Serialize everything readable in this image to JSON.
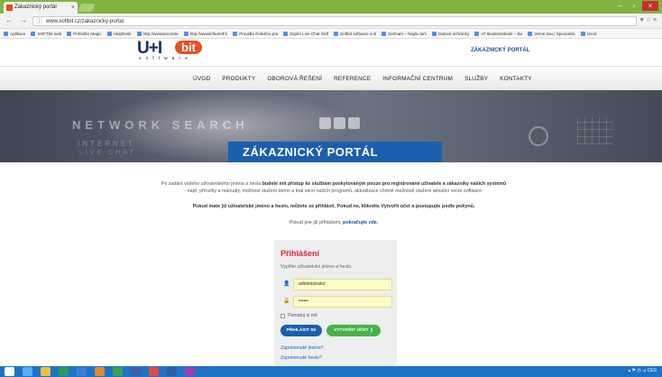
{
  "browser": {
    "tab_title": "Zákaznický portál",
    "tab_close": "×",
    "url": "www.softbit.cz/zakaznicky-portal",
    "nav_buttons": "← → C",
    "window_controls": [
      "–",
      "▫",
      "×"
    ],
    "bookmarks": [
      "Aplikace",
      "SOFTbit web",
      "Prihlašte Magic",
      "HelpDesk",
      "http://wwwsecurete",
      "http://wwwinfluentFo",
      "Pravidla českého pra",
      "Zopim Live Chat Soft",
      "Softbit software a sl",
      "Seznam – Najdu tam",
      "Datové schránky",
      "AT Businessbank – Bu",
      "Verne.sou | Specialize",
      "Úvod"
    ]
  },
  "header": {
    "logo_text": "U+I",
    "logo_badge": "bit",
    "logo_sub": "software",
    "portal_link": "ZÁKAZNICKÝ PORTÁL"
  },
  "menu": [
    "ÚVOD",
    "PRODUKTY",
    "OBOROVÁ ŘEŠENÍ",
    "REFERENCE",
    "INFORMAČNÍ CENTRUM",
    "SLUŽBY",
    "KONTAKTY"
  ],
  "banner": {
    "network_search": "NETWORK SEARCH",
    "internet": "INTERNET",
    "live_chat": "LIVE CHAT",
    "portal_title": "ZÁKAZNICKÝ PORTÁL"
  },
  "intro": {
    "line1_pre": "Po zadání vašeho uživatelského jména a hesla ",
    "line1_bold": "budete mít přístup ke službám poskytovaným pouze pro registrované uživatele a zákazníky našich systémů",
    "line2": "- např. příručky a manuály, možnost stažení demo a trial verzí našich programů, aktualizace včetně možností stažení aktuální verze software.",
    "line3": "Pokud máte již uživatelské jméno a heslo, můžete se přihlásit. Pokud ne, klikněte Vytvořit účet a postupujte podle pokynů.",
    "line4_pre": "Pokud jste již přihlášeni, ",
    "line4_link": "pokračujte zde."
  },
  "login": {
    "title": "Přihlášení",
    "subtitle": "Vyplňte uživatelské jméno a heslo.",
    "username_value": "administrator",
    "password_value": "••••••",
    "remember_label": "Pamatuj si mě",
    "login_button": "PŘIHLÁSIT SE",
    "create_button": "VYTVOŘIT ÚČET ❯",
    "forgot_username": "Zapomenuté jméno?",
    "forgot_password": "Zapomenuté heslo?"
  },
  "taskbar": {
    "tray_text": "▴ ⚑ ◷ ⊿ CES"
  },
  "colors": {
    "brand_blue": "#1b5fae",
    "accent_red": "#d9263c",
    "create_green": "#49b24a",
    "chrome_green": "#7fb540",
    "taskbar_blue": "#1f73c6"
  }
}
